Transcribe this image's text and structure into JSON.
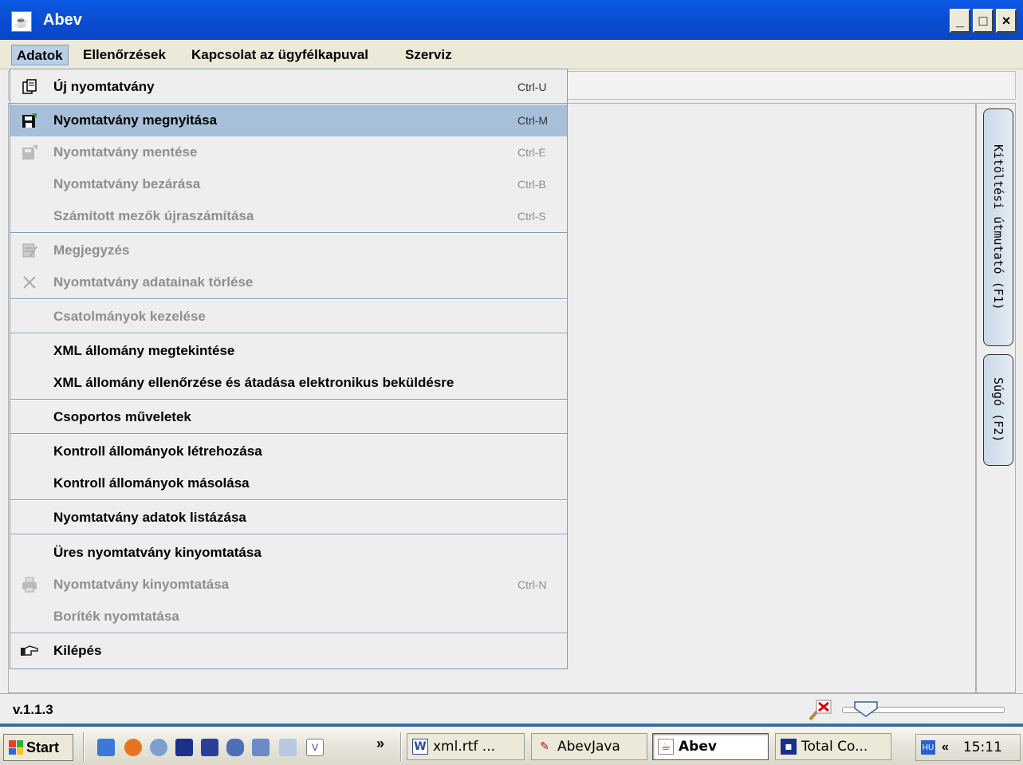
{
  "window": {
    "title": "Abev"
  },
  "window_buttons": {
    "minimize": "_",
    "maximize": "□",
    "close": "×"
  },
  "menubar": {
    "items": [
      {
        "label": "Adatok"
      },
      {
        "label": "Ellenőrzések"
      },
      {
        "label": "Kapcsolat az ügyfélkapuval"
      },
      {
        "label": "Szerviz"
      }
    ]
  },
  "dropdown": {
    "items": [
      {
        "label": "Új nyomtatvány",
        "shortcut": "Ctrl-U",
        "icon": "new-form-icon",
        "enabled": true
      },
      {
        "label": "Nyomtatvány megnyitása",
        "shortcut": "Ctrl-M",
        "icon": "open-disk-icon",
        "enabled": true,
        "selected": true
      },
      {
        "label": "Nyomtatvány mentése",
        "shortcut": "Ctrl-E",
        "icon": "save-disk-icon",
        "enabled": false
      },
      {
        "label": "Nyomtatvány bezárása",
        "shortcut": "Ctrl-B",
        "enabled": false
      },
      {
        "label": "Számított mezők újraszámítása",
        "shortcut": "Ctrl-S",
        "enabled": false
      },
      {
        "label": "Megjegyzés",
        "icon": "note-icon",
        "enabled": false
      },
      {
        "label": "Nyomtatvány adatainak törlése",
        "icon": "delete-x-icon",
        "enabled": false
      },
      {
        "label": "Csatolmányok kezelése",
        "enabled": false
      },
      {
        "label": "XML állomány megtekintése",
        "enabled": true
      },
      {
        "label": "XML állomány ellenőrzése és átadása elektronikus beküldésre",
        "enabled": true
      },
      {
        "label": "Csoportos műveletek",
        "enabled": true
      },
      {
        "label": "Kontroll állományok létrehozása",
        "enabled": true
      },
      {
        "label": "Kontroll állományok másolása",
        "enabled": true
      },
      {
        "label": "Nyomtatvány adatok listázása",
        "enabled": true
      },
      {
        "label": "Üres nyomtatvány kinyomtatása",
        "enabled": true
      },
      {
        "label": "Nyomtatvány kinyomtatása",
        "shortcut": "Ctrl-N",
        "icon": "printer-icon",
        "enabled": false
      },
      {
        "label": "Boríték nyomtatása",
        "enabled": false
      },
      {
        "label": "Kilépés",
        "icon": "exit-hand-icon",
        "enabled": true
      }
    ]
  },
  "side_tabs": {
    "help_guide": "Kitöltési útmutató (F1)",
    "help": "Súgó (F2)"
  },
  "statusbar": {
    "version": "v.1.1.3"
  },
  "taskbar": {
    "start_label": "Start",
    "overflow": "»",
    "tasks": [
      {
        "label": "xml.rtf ...",
        "icon": "word-icon"
      },
      {
        "label": "AbevJava",
        "icon": "edit-icon"
      },
      {
        "label": "Abev",
        "icon": "java-icon",
        "active": true
      },
      {
        "label": "Total Co...",
        "icon": "floppy-icon"
      }
    ],
    "tray": {
      "lang": "HU",
      "collapse": "«",
      "clock": "15:11"
    }
  }
}
